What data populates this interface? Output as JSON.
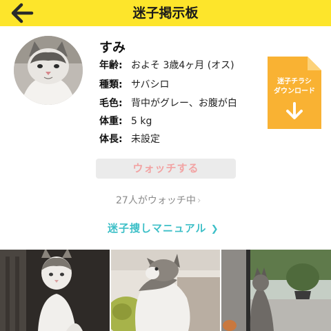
{
  "header": {
    "title": "迷子掲示板",
    "back_icon": "arrow-left-icon",
    "background": "#fde52b"
  },
  "pet": {
    "name": "すみ",
    "details": [
      {
        "label": "年齢:",
        "value": "およそ 3歳4ヶ月 (オス)"
      },
      {
        "label": "種類:",
        "value": "サバシロ"
      },
      {
        "label": "毛色:",
        "value": "背中がグレー、お腹が白"
      },
      {
        "label": "体重:",
        "value": "5 kg"
      },
      {
        "label": "体長:",
        "value": "未設定"
      }
    ]
  },
  "flyer": {
    "line1": "迷子チラシ",
    "line2": "ダウンロード",
    "icon": "download-arrow-icon",
    "color": "#f9b233"
  },
  "watch": {
    "button_label": "ウォッチする",
    "count_text": "27人がウォッチ中",
    "chevron": "›"
  },
  "manual": {
    "label": "迷子捜しマニュアル",
    "chevron": "❯",
    "color": "#3cbfc7"
  },
  "photos": [
    {
      "alt": "cat-photo-1"
    },
    {
      "alt": "cat-photo-2"
    },
    {
      "alt": "cat-photo-3"
    }
  ]
}
